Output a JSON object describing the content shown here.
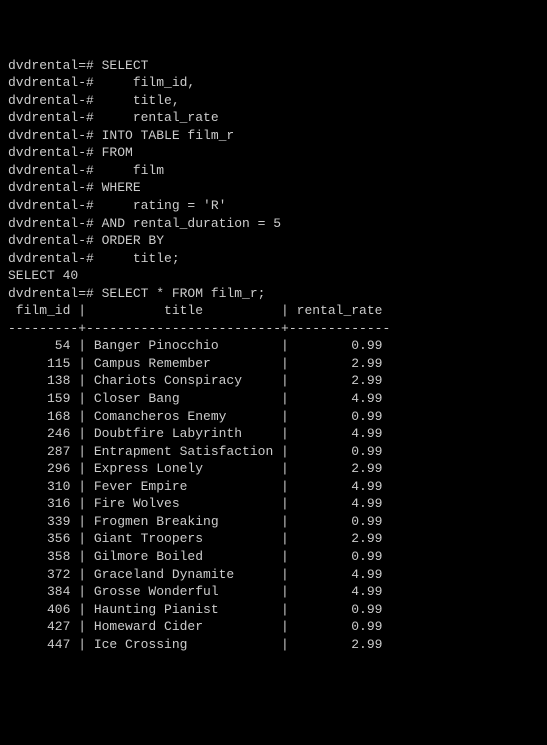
{
  "prompt_main": "dvdrental=#",
  "prompt_cont": "dvdrental-#",
  "query_lines": [
    "SELECT",
    "    film_id,",
    "    title,",
    "    rental_rate",
    "INTO TABLE film_r",
    "FROM",
    "    film",
    "WHERE",
    "    rating = 'R'",
    "AND rental_duration = 5",
    "ORDER BY",
    "    title;"
  ],
  "result1": "SELECT 40",
  "query2": "SELECT * FROM film_r;",
  "headers": {
    "col1": "film_id",
    "col2": "title",
    "col3": "rental_rate"
  },
  "separator_line": "---------+-------------------------+-------------",
  "rows": [
    {
      "film_id": "54",
      "title": "Banger Pinocchio",
      "rental_rate": "0.99"
    },
    {
      "film_id": "115",
      "title": "Campus Remember",
      "rental_rate": "2.99"
    },
    {
      "film_id": "138",
      "title": "Chariots Conspiracy",
      "rental_rate": "2.99"
    },
    {
      "film_id": "159",
      "title": "Closer Bang",
      "rental_rate": "4.99"
    },
    {
      "film_id": "168",
      "title": "Comancheros Enemy",
      "rental_rate": "0.99"
    },
    {
      "film_id": "246",
      "title": "Doubtfire Labyrinth",
      "rental_rate": "4.99"
    },
    {
      "film_id": "287",
      "title": "Entrapment Satisfaction",
      "rental_rate": "0.99"
    },
    {
      "film_id": "296",
      "title": "Express Lonely",
      "rental_rate": "2.99"
    },
    {
      "film_id": "310",
      "title": "Fever Empire",
      "rental_rate": "4.99"
    },
    {
      "film_id": "316",
      "title": "Fire Wolves",
      "rental_rate": "4.99"
    },
    {
      "film_id": "339",
      "title": "Frogmen Breaking",
      "rental_rate": "0.99"
    },
    {
      "film_id": "356",
      "title": "Giant Troopers",
      "rental_rate": "2.99"
    },
    {
      "film_id": "358",
      "title": "Gilmore Boiled",
      "rental_rate": "0.99"
    },
    {
      "film_id": "372",
      "title": "Graceland Dynamite",
      "rental_rate": "4.99"
    },
    {
      "film_id": "384",
      "title": "Grosse Wonderful",
      "rental_rate": "4.99"
    },
    {
      "film_id": "406",
      "title": "Haunting Pianist",
      "rental_rate": "0.99"
    },
    {
      "film_id": "427",
      "title": "Homeward Cider",
      "rental_rate": "0.99"
    },
    {
      "film_id": "447",
      "title": "Ice Crossing",
      "rental_rate": "2.99"
    }
  ]
}
